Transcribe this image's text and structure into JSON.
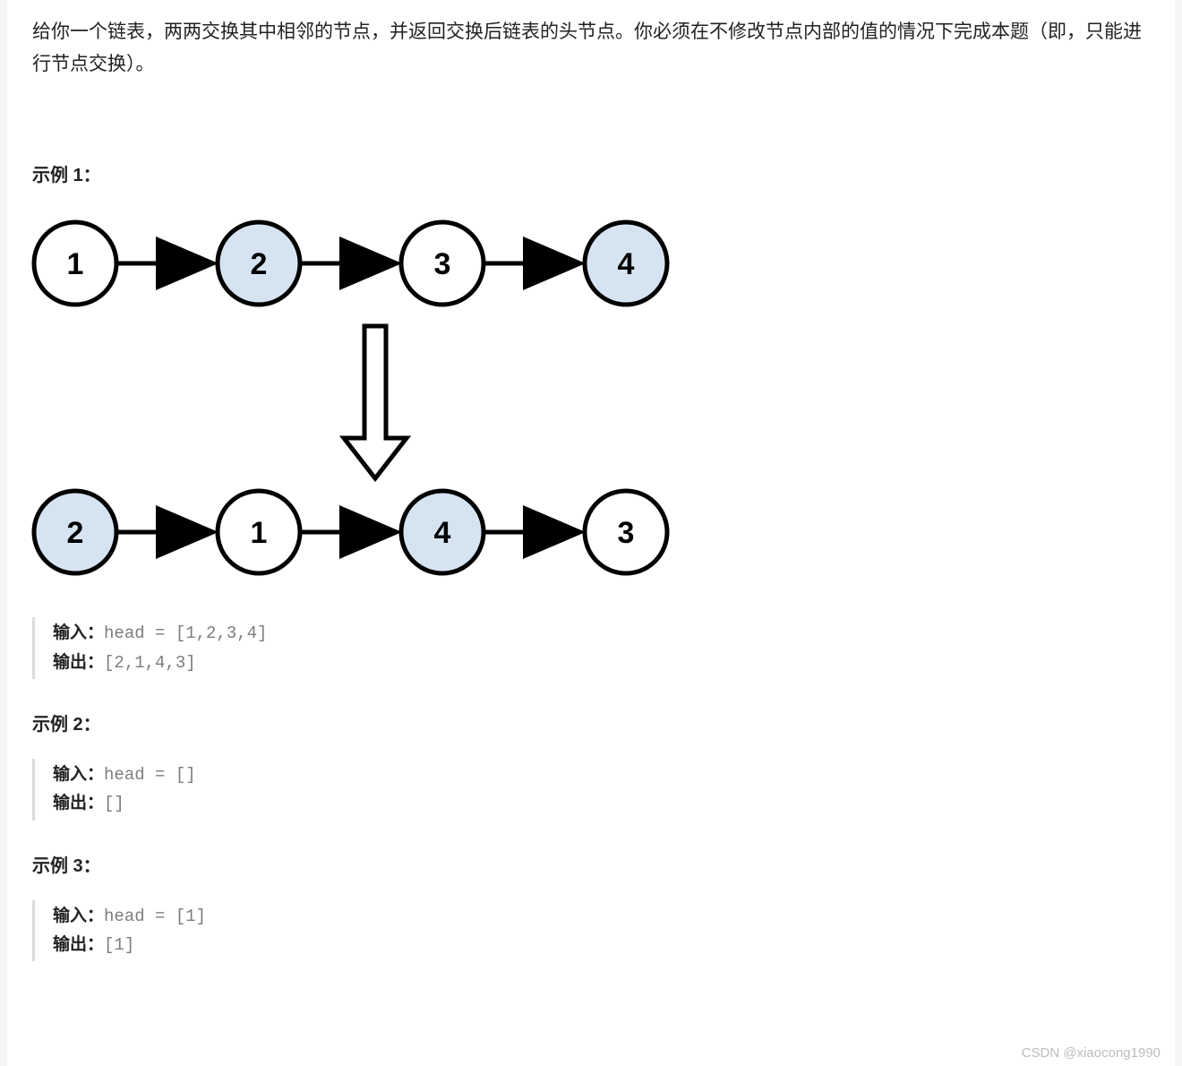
{
  "description": "给你一个链表，两两交换其中相邻的节点，并返回交换后链表的头节点。你必须在不修改节点内部的值的情况下完成本题（即，只能进行节点交换）。",
  "examples": [
    {
      "title": "示例 1：",
      "input_label": "输入：",
      "input_value": "head = [1,2,3,4]",
      "output_label": "输出：",
      "output_value": "[2,1,4,3]",
      "has_diagram": true
    },
    {
      "title": "示例 2：",
      "input_label": "输入：",
      "input_value": "head = []",
      "output_label": "输出：",
      "output_value": "[]",
      "has_diagram": false
    },
    {
      "title": "示例 3：",
      "input_label": "输入：",
      "input_value": "head = [1]",
      "output_label": "输出：",
      "output_value": "[1]",
      "has_diagram": false
    }
  ],
  "diagram": {
    "top_row": [
      {
        "value": "1",
        "shaded": false
      },
      {
        "value": "2",
        "shaded": true
      },
      {
        "value": "3",
        "shaded": false
      },
      {
        "value": "4",
        "shaded": true
      }
    ],
    "bottom_row": [
      {
        "value": "2",
        "shaded": true
      },
      {
        "value": "1",
        "shaded": false
      },
      {
        "value": "4",
        "shaded": true
      },
      {
        "value": "3",
        "shaded": false
      }
    ],
    "colors": {
      "shaded": "#d6e4f2",
      "unshaded": "#ffffff",
      "stroke": "#000000"
    }
  },
  "watermark": "CSDN @xiaocong1990"
}
